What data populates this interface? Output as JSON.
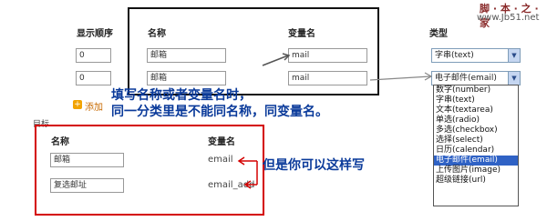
{
  "watermark": {
    "line1": "脚 · 本 · 之 · 家",
    "line2": "www.Jb51.net"
  },
  "header": {
    "order": "显示顺序",
    "name": "名称",
    "var": "变量名",
    "type": "类型"
  },
  "rows": [
    {
      "order": "0",
      "name": "邮箱",
      "var": "mail",
      "type": "字串(text)"
    },
    {
      "order": "0",
      "name": "邮箱",
      "var": "mail",
      "type": "电子邮件(email)"
    }
  ],
  "add_label": "添加",
  "cut_label": "目标",
  "note": {
    "line1": "填写名称或者变量名时，",
    "line2": "同一分类里是不能同名称，同变量名。"
  },
  "lower_header": {
    "name": "名称",
    "var": "变量名"
  },
  "lower_rows": [
    {
      "name": "邮箱",
      "var": "email"
    },
    {
      "name": "复选邮址",
      "var": "email_add"
    }
  ],
  "note2": "但是你可以这样写",
  "type_options": [
    "数字(number)",
    "字串(text)",
    "文本(textarea)",
    "单选(radio)",
    "多选(checkbox)",
    "选择(select)",
    "日历(calendar)",
    "电子邮件(email)",
    "上传图片(image)",
    "超级链接(url)"
  ],
  "selected_type_index": 7
}
